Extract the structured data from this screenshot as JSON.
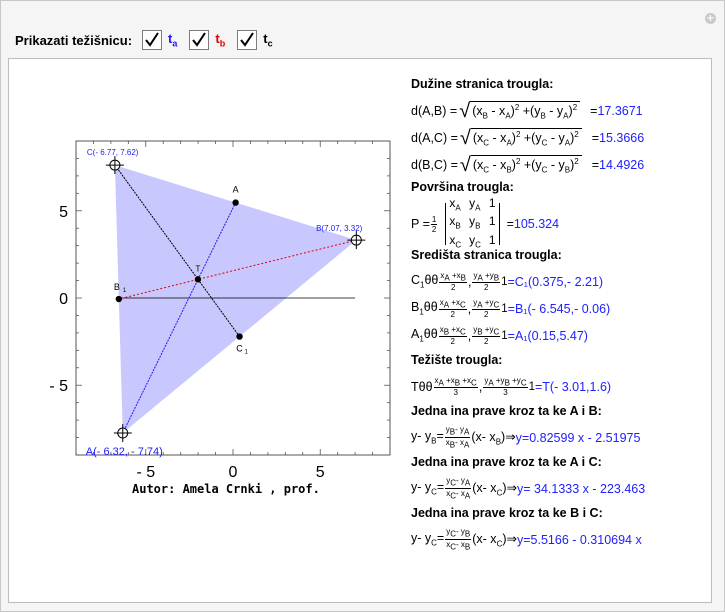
{
  "controls": {
    "label": "Prikazati težišnicu:",
    "checkboxes": [
      {
        "name": "t",
        "sub": "a",
        "checked": true,
        "color": "#1a1aff"
      },
      {
        "name": "t",
        "sub": "b",
        "checked": true,
        "color": "#e00000"
      },
      {
        "name": "t",
        "sub": "c",
        "checked": true,
        "color": "#000000"
      }
    ]
  },
  "plot": {
    "xticks": [
      "- 5",
      "0",
      "5"
    ],
    "yticks": [
      "5",
      "0",
      "- 5"
    ],
    "labels": {
      "C": "C(- 6.77, 7.62)",
      "B": "B(7.07, 3.32)",
      "A": "A(- 6.32, - 7.74)",
      "A1": "A",
      "B1": "B",
      "C1": "C",
      "T": "T",
      "sub1": "1"
    },
    "colors": {
      "fill": "#c8c8ff",
      "median_a": "#1a1aff",
      "median_b": "#e00000",
      "median_c": "#000000"
    }
  },
  "chart_data": {
    "type": "scatter",
    "title": "",
    "xlim": [
      -9,
      9
    ],
    "ylim": [
      -9,
      9
    ],
    "points": [
      {
        "name": "A",
        "x": -6.32,
        "y": -7.74
      },
      {
        "name": "B",
        "x": 7.07,
        "y": 3.32
      },
      {
        "name": "C",
        "x": -6.77,
        "y": 7.62
      },
      {
        "name": "A1",
        "x": 0.15,
        "y": 5.47
      },
      {
        "name": "B1",
        "x": -6.545,
        "y": -0.06
      },
      {
        "name": "C1",
        "x": 0.375,
        "y": -2.21
      },
      {
        "name": "T",
        "x": -2.01,
        "y": 1.07
      }
    ]
  },
  "author": "Autor: Amela Crnki , prof.",
  "info": {
    "h_lengths": "Dužine stranica trougla:",
    "dAB": "d(A,B) =",
    "dAB_val": "=17.3671",
    "dAC": "d(A,C) =",
    "dAC_val": "=15.3666",
    "dBC": "d(B,C) =",
    "dBC_val": "=14.4926",
    "h_area": "Površina trougla:",
    "area_lhs": "P =",
    "area_val": "=105.324",
    "h_mid": "Središta stranica trougla:",
    "c1_val": "=C₁(0.375,- 2.21)",
    "b1_val": "=B₁(- 6.545,- 0.06)",
    "a1_val": "=A₁(0.15,5.47)",
    "h_centroid": "Težište trougla:",
    "t_val": "=T(- 3.01,1.6)",
    "h_lineAB": "Jedna  ina prave kroz ta  ke A i B:",
    "lineAB_val": "y=0.82599 x -  2.51975",
    "h_lineAC": "Jedna  ina prave kroz ta  ke A i C:",
    "lineAC_val": "y= 34.1333 x -  223.463",
    "h_lineBC": "Jedna  ina prave kroz ta  ke B i C:",
    "lineBC_val": "y=5.5166 -  0.310694 x"
  }
}
